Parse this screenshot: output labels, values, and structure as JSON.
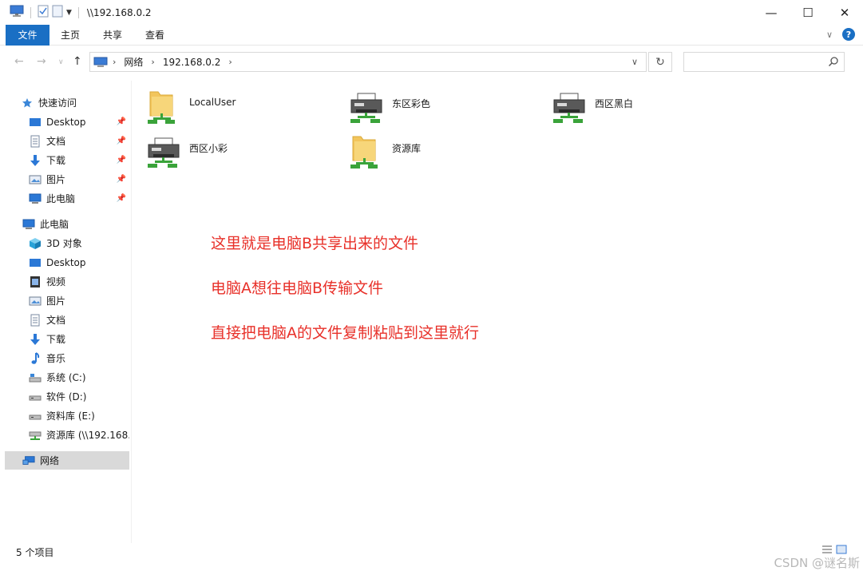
{
  "window": {
    "title": "\\\\192.168.0.2",
    "controls": {
      "minimize": "—",
      "maximize": "☐",
      "close": "✕"
    }
  },
  "ribbon": {
    "tabs": [
      "文件",
      "主页",
      "共享",
      "查看"
    ],
    "help": "?"
  },
  "address": {
    "segments": [
      "网络",
      "192.168.0.2"
    ],
    "search_placeholder": ""
  },
  "sidebar": {
    "quick_access": {
      "label": "快速访问",
      "items": [
        {
          "label": "Desktop",
          "icon": "desktop-icon",
          "pinned": true
        },
        {
          "label": "文档",
          "icon": "document-icon",
          "pinned": true
        },
        {
          "label": "下载",
          "icon": "download-icon",
          "pinned": true
        },
        {
          "label": "图片",
          "icon": "picture-icon",
          "pinned": true
        },
        {
          "label": "此电脑",
          "icon": "computer-icon",
          "pinned": true
        }
      ]
    },
    "this_pc": {
      "label": "此电脑",
      "items": [
        {
          "label": "3D 对象",
          "icon": "cube-icon"
        },
        {
          "label": "Desktop",
          "icon": "desktop-icon"
        },
        {
          "label": "视频",
          "icon": "video-icon"
        },
        {
          "label": "图片",
          "icon": "picture-icon"
        },
        {
          "label": "文档",
          "icon": "document-icon"
        },
        {
          "label": "下载",
          "icon": "download-icon"
        },
        {
          "label": "音乐",
          "icon": "music-icon"
        },
        {
          "label": "系统 (C:)",
          "icon": "drive-icon"
        },
        {
          "label": "软件 (D:)",
          "icon": "drive-icon"
        },
        {
          "label": "资料库 (E:)",
          "icon": "drive-icon"
        },
        {
          "label": "资源库 (\\\\192.168.",
          "icon": "network-drive-icon"
        }
      ]
    },
    "network": {
      "label": "网络",
      "selected": true
    }
  },
  "shares": [
    {
      "label": "LocalUser",
      "type": "folder"
    },
    {
      "label": "东区彩色",
      "type": "printer"
    },
    {
      "label": "西区黑白",
      "type": "printer"
    },
    {
      "label": "西区小彩",
      "type": "printer"
    },
    {
      "label": "资源库",
      "type": "folder"
    }
  ],
  "annotations": [
    "这里就是电脑B共享出来的文件",
    "电脑A想往电脑B传输文件",
    "直接把电脑A的文件复制粘贴到这里就行"
  ],
  "status": {
    "item_count": "5 个项目",
    "watermark": "CSDN @谜名斯"
  },
  "colors": {
    "accent": "#1a6fc4",
    "annotation": "#e8312a",
    "folder": "#f2c55c",
    "selected_bg": "#d9d9d9"
  }
}
